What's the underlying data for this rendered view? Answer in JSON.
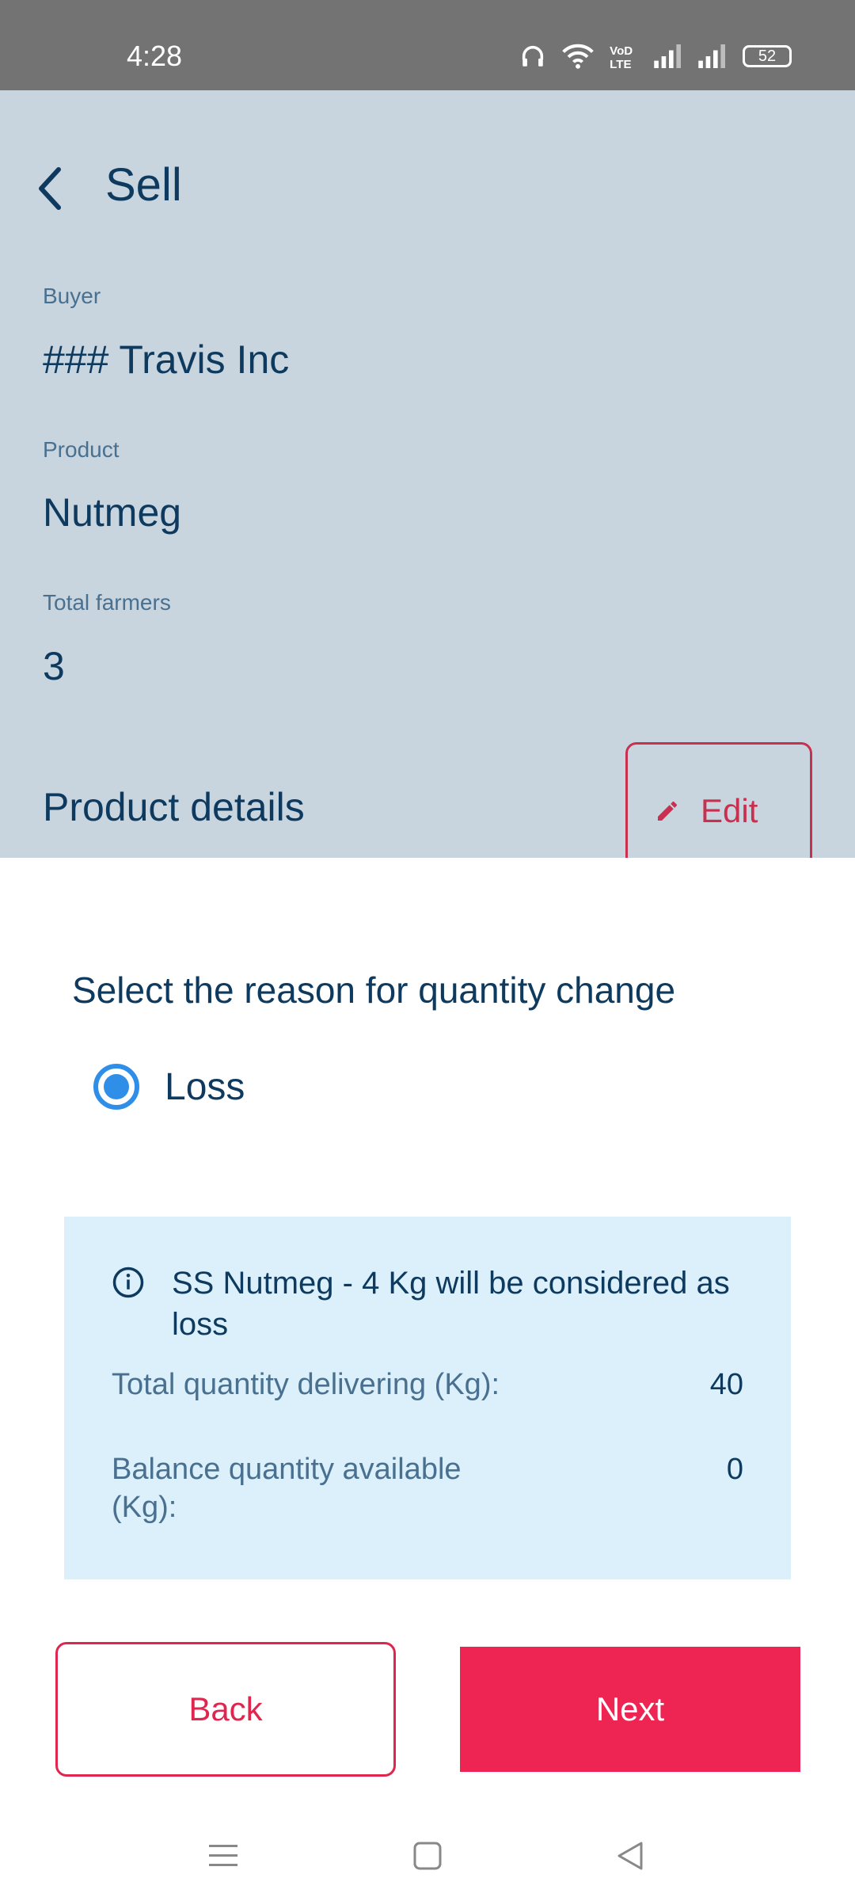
{
  "status_bar": {
    "time": "4:28",
    "battery": "52",
    "icons": [
      "headphones-icon",
      "wifi-icon",
      "volte-icon",
      "signal-icon",
      "signal-icon",
      "battery-icon"
    ]
  },
  "header": {
    "title": "Sell",
    "back_icon": "chevron-left-icon"
  },
  "fields": {
    "buyer_label": "Buyer",
    "buyer_value": "### Travis Inc",
    "product_label": "Product",
    "product_value": "Nutmeg",
    "farmers_label": "Total farmers",
    "farmers_value": "3"
  },
  "product_details": {
    "title": "Product details",
    "edit_label": "Edit",
    "edit_icon": "pencil-icon"
  },
  "sheet": {
    "title": "Select the reason for quantity change",
    "option_label": "Loss",
    "option_selected": true,
    "info": {
      "message": "SS Nutmeg - 4 Kg will be considered as loss",
      "total_label": "Total quantity delivering (Kg):",
      "total_value": "40",
      "balance_label": "Balance quantity available (Kg):",
      "balance_value": "0"
    },
    "back_label": "Back",
    "next_label": "Next"
  },
  "nav": [
    "menu-icon",
    "home-square-icon",
    "back-triangle-icon"
  ],
  "colors": {
    "accent": "#ee2452",
    "primary_text": "#0d3a5e",
    "radio": "#2f8fe8",
    "info_bg": "#dbf0fb"
  }
}
